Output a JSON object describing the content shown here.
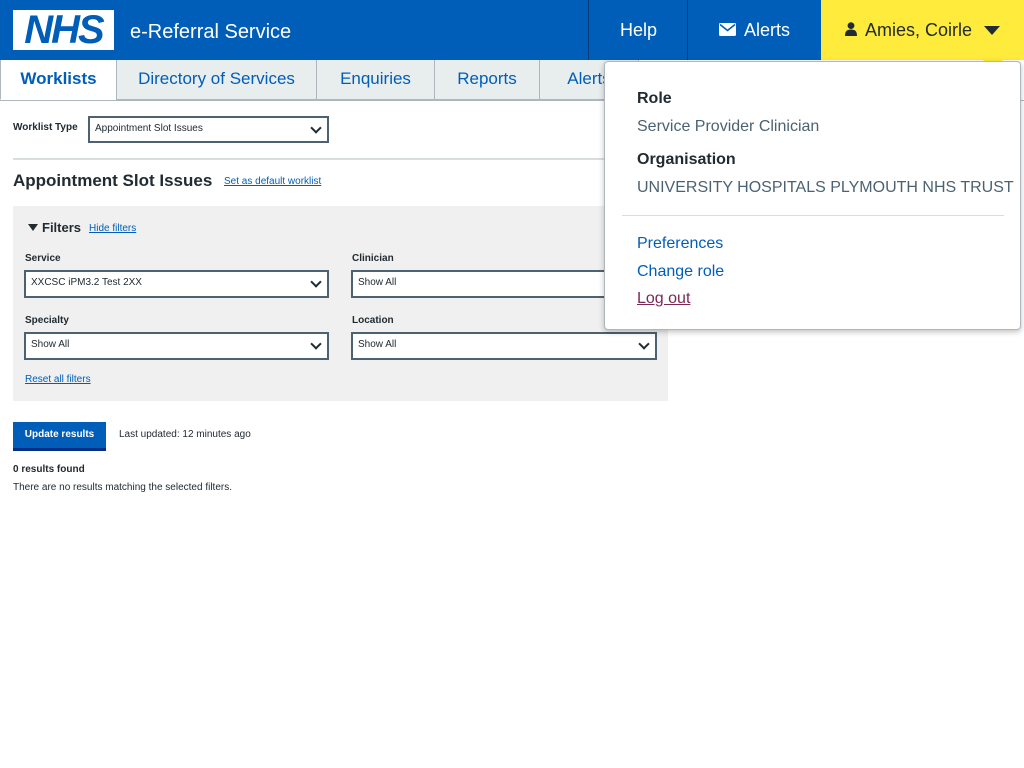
{
  "header": {
    "logo_text": "NHS",
    "service_name": "e-Referral Service",
    "help_label": "Help",
    "alerts_label": "Alerts",
    "user_name": "Amies, Coirle"
  },
  "tabs": [
    {
      "label": "Worklists",
      "active": true
    },
    {
      "label": "Directory of Services"
    },
    {
      "label": "Enquiries"
    },
    {
      "label": "Reports"
    },
    {
      "label": "Alerts"
    }
  ],
  "worklist": {
    "type_label": "Worklist Type",
    "type_value": "Appointment Slot Issues",
    "title": "Appointment Slot Issues",
    "set_default_link": "Set as default worklist"
  },
  "filters": {
    "toggle_label": "Filters",
    "hide_link": "Hide filters",
    "service_label": "Service",
    "service_value": "XXCSC iPM3.2 Test 2XX",
    "clinician_label": "Clinician",
    "clinician_value": "Show All",
    "specialty_label": "Specialty",
    "specialty_value": "Show All",
    "location_label": "Location",
    "location_value": "Show All",
    "reset_link": "Reset all filters"
  },
  "results": {
    "update_button": "Update results",
    "last_updated": "Last updated: 12 minutes ago",
    "count_text": "0 results found",
    "empty_text": "There are no results matching the selected filters."
  },
  "user_menu": {
    "role_heading": "Role",
    "role_value": "Service Provider Clinician",
    "org_heading": "Organisation",
    "org_value": "UNIVERSITY HOSPITALS PLYMOUTH NHS TRUST",
    "preferences": "Preferences",
    "change_role": "Change role",
    "log_out": "Log out"
  },
  "icons": {
    "alerts": "envelope-icon",
    "user": "user-icon",
    "caret": "caret-down-icon"
  },
  "colors": {
    "nhs_blue": "#005eb8",
    "highlight_yellow": "#ffeb3b",
    "visited_link": "#7c2855"
  }
}
